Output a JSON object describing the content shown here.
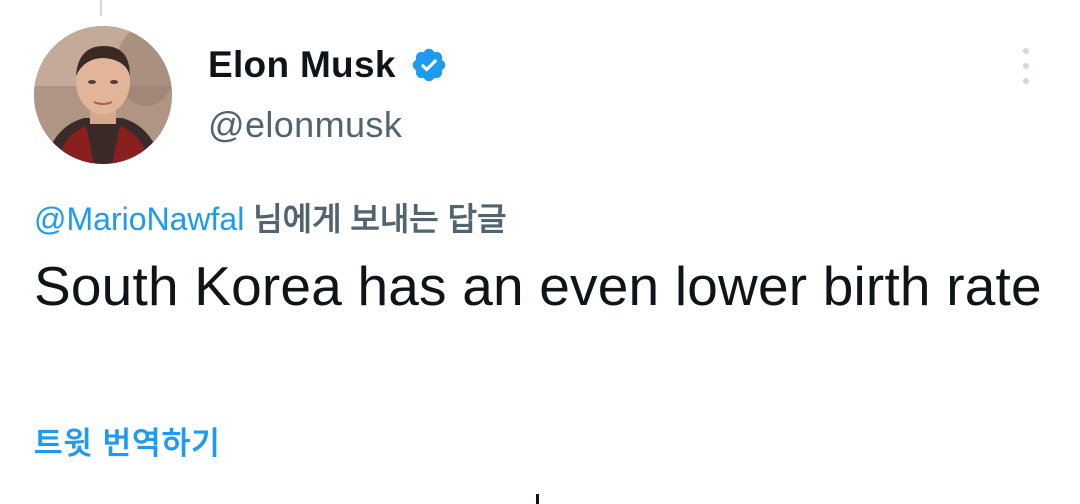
{
  "author": {
    "display_name": "Elon Musk",
    "handle": "@elonmusk",
    "verified": true,
    "verified_icon": "verified-badge-icon",
    "verified_color": "#1d9bf0"
  },
  "reply_context": {
    "mention": "@MarioNawfal",
    "suffix": " 님에게 보내는 답글"
  },
  "tweet": {
    "text": "South Korea has an even lower birth rate"
  },
  "actions": {
    "translate_label": "트윗 번역하기",
    "more_icon": "more-vertical-icon"
  },
  "colors": {
    "accent": "#1d9bf0",
    "text_primary": "#0f1419",
    "text_secondary": "#536471"
  }
}
